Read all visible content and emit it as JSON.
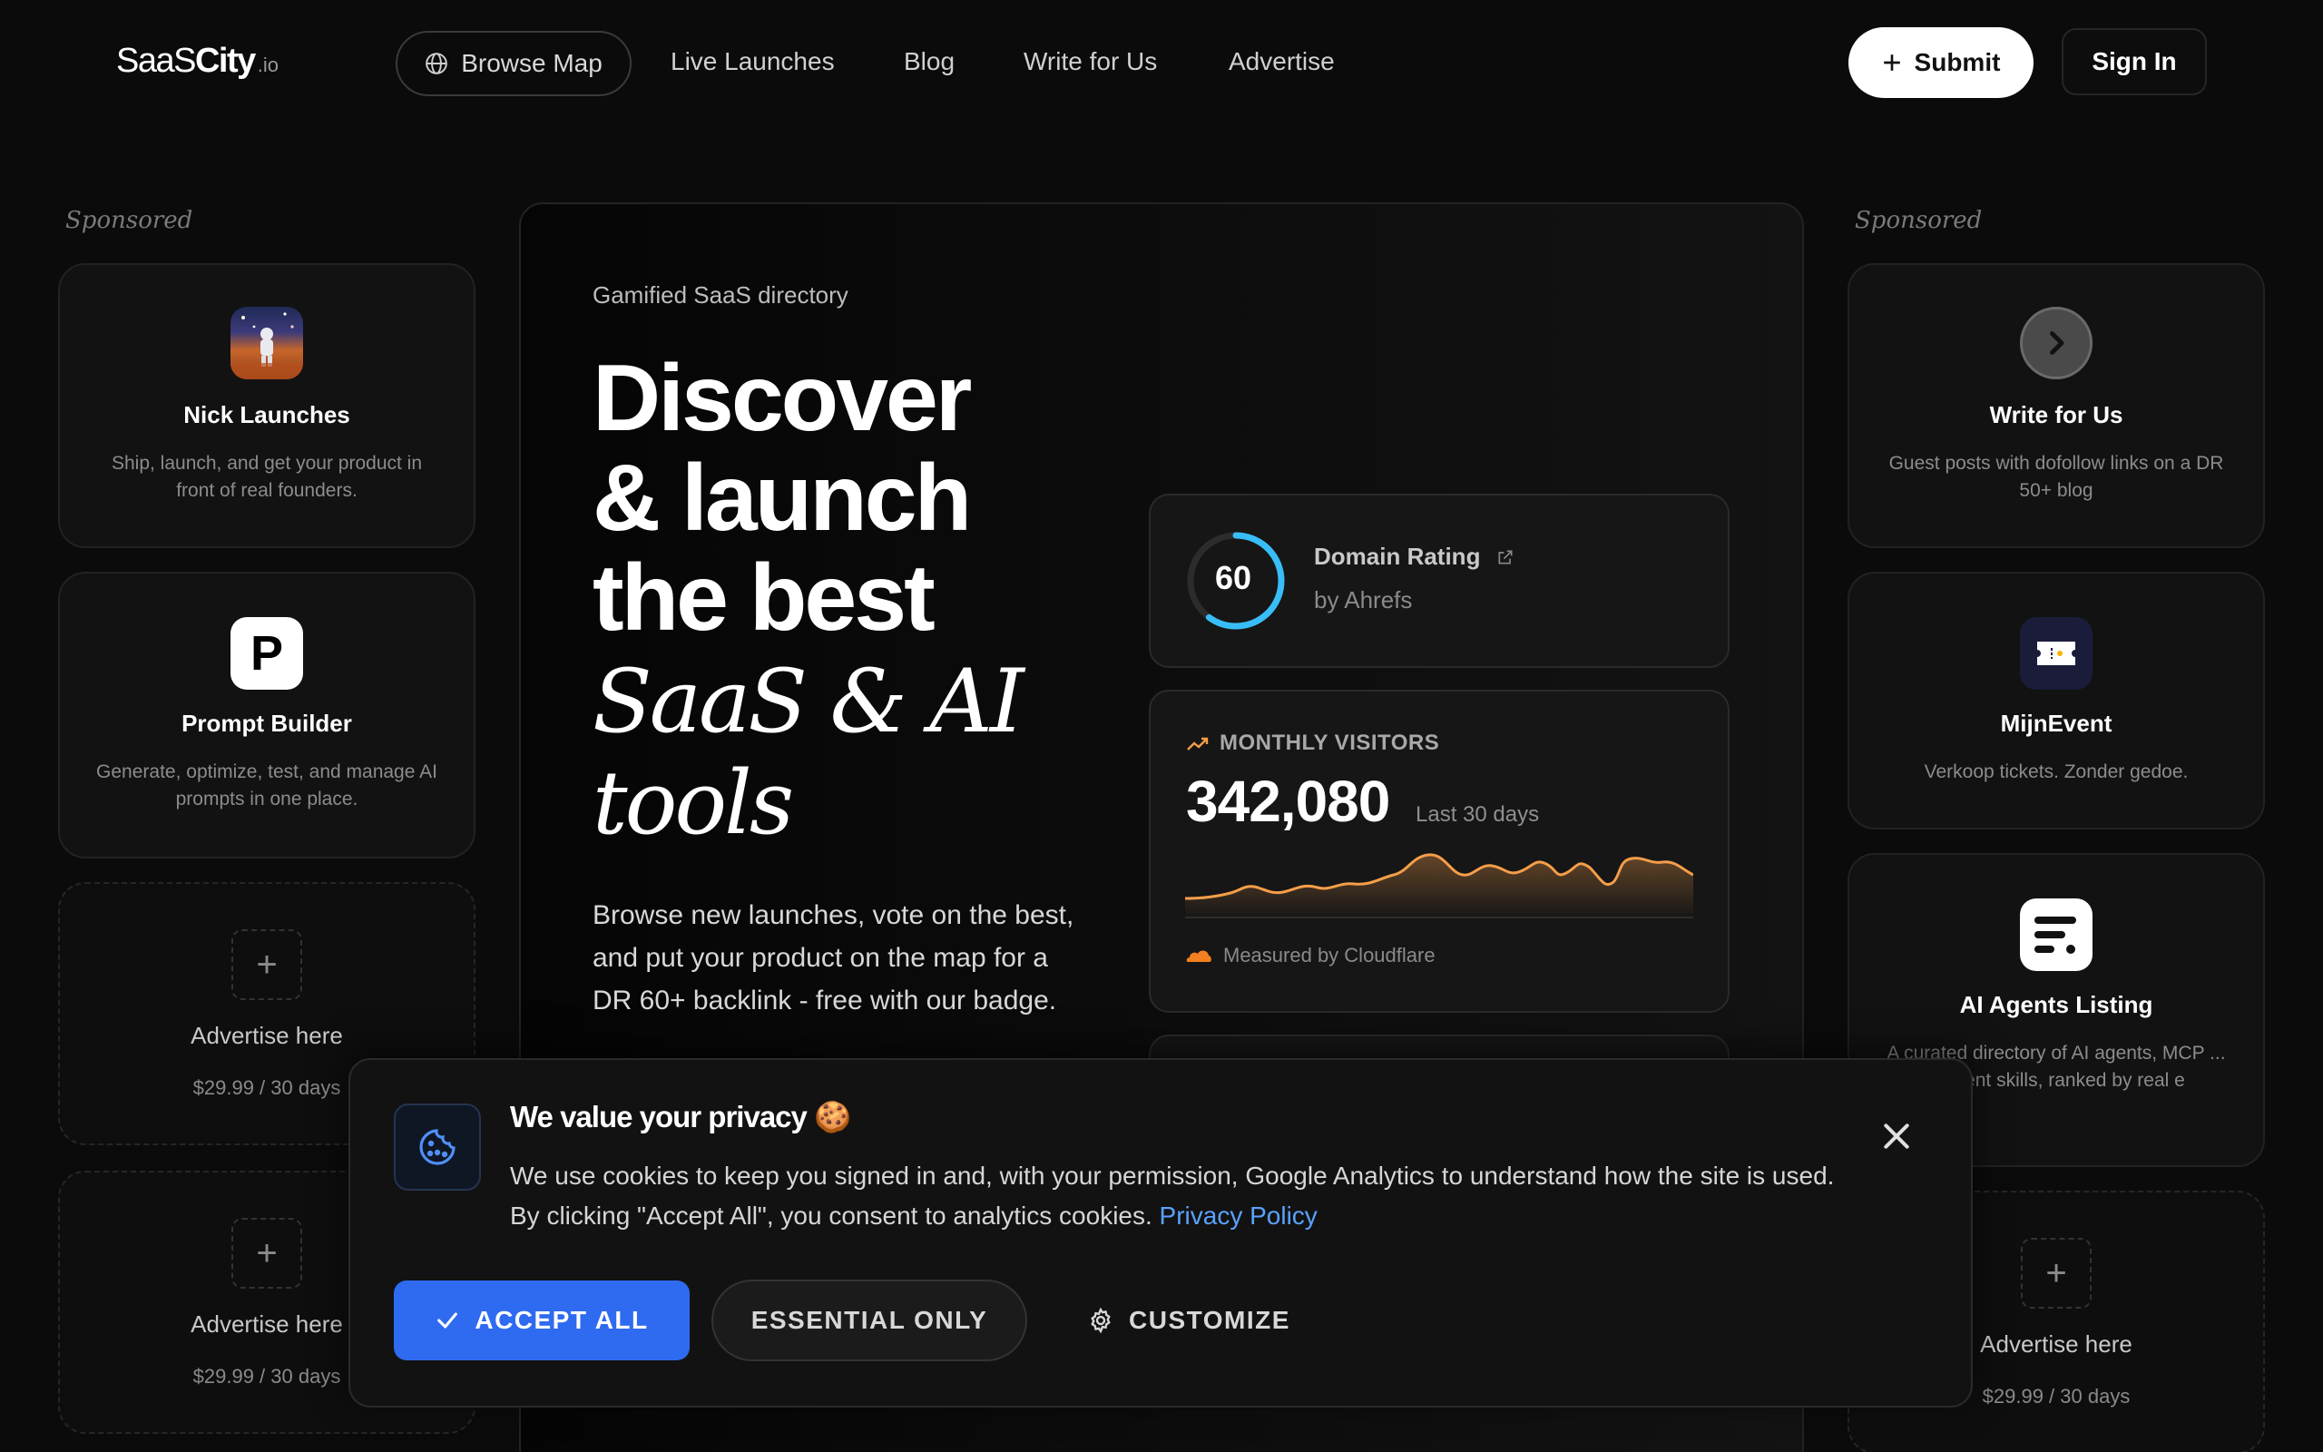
{
  "header": {
    "logo_main": "SaaS",
    "logo_bold": "City",
    "logo_tld": ".io",
    "nav": {
      "browse_map": "Browse Map",
      "live_launches": "Live Launches",
      "blog": "Blog",
      "write_for_us": "Write for Us",
      "advertise": "Advertise"
    },
    "submit_label": "Submit",
    "sign_in_label": "Sign In"
  },
  "left_sidebar": {
    "label": "Sponsored",
    "cards": [
      {
        "title": "Nick Launches",
        "description": "Ship, launch, and get your product in front of real founders.",
        "icon": "astronaut-image"
      },
      {
        "title": "Prompt Builder",
        "description": "Generate, optimize, test, and manage AI prompts in one place.",
        "icon": "letter-p-icon",
        "icon_letter": "P"
      }
    ],
    "ad_slots": [
      {
        "title": "Advertise here",
        "price": "$29.99 / 30 days"
      },
      {
        "title": "Advertise here",
        "price": "$29.99 / 30 days"
      }
    ]
  },
  "right_sidebar": {
    "label": "Sponsored",
    "cards": [
      {
        "title": "Write for Us",
        "description": "Guest posts with dofollow links on a DR 50+ blog",
        "icon": "chevron-right-icon"
      },
      {
        "title": "MijnEvent",
        "description": "Verkoop tickets. Zonder gedoe.",
        "icon": "ticket-icon"
      },
      {
        "title": "AI Agents Listing",
        "description": "A curated directory of AI agents, MCP ... d agent skills, ranked by real e",
        "icon": "list-icon"
      }
    ],
    "ad_slots": [
      {
        "title": "Advertise here",
        "price": "$29.99 / 30 days"
      }
    ]
  },
  "hero": {
    "kicker": "Gamified SaaS directory",
    "headline_lines": [
      "Discover",
      "& launch",
      "the best"
    ],
    "headline_italic_lines": [
      "SaaS & AI",
      "tools"
    ],
    "lead": "Browse new launches, vote on the best, and put your product on the map for a DR 60+ backlink - free with our badge."
  },
  "stats": {
    "domain_rating": {
      "value": "60",
      "ring_fraction": 0.6,
      "title": "Domain Rating",
      "source": "by Ahrefs",
      "accent": "#38bdf8"
    },
    "monthly_visitors": {
      "label": "MONTHLY VISITORS",
      "value": "342,080",
      "period": "Last 30 days",
      "footer": "Measured by Cloudflare",
      "accent": "#f59e4a"
    }
  },
  "cookie_banner": {
    "title": "We value your privacy",
    "title_emoji": "🍪",
    "body": "We use cookies to keep you signed in and, with your permission, Google Analytics to understand how the site is used. By clicking \"Accept All\", you consent to analytics cookies.",
    "privacy_link": "Privacy Policy",
    "accept_label": "ACCEPT ALL",
    "essential_label": "ESSENTIAL ONLY",
    "customize_label": "CUSTOMIZE",
    "accent": "#2f6bf0"
  }
}
